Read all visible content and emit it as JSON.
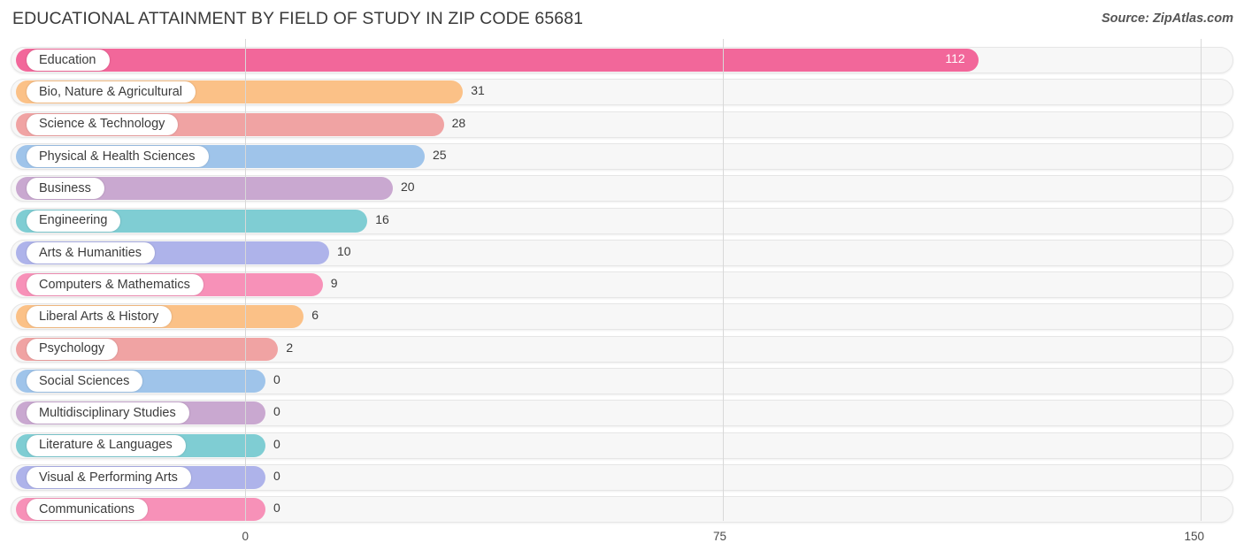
{
  "header": {
    "title": "EDUCATIONAL ATTAINMENT BY FIELD OF STUDY IN ZIP CODE 65681",
    "source": "Source: ZipAtlas.com"
  },
  "chart_data": {
    "type": "bar",
    "orientation": "horizontal",
    "title": "EDUCATIONAL ATTAINMENT BY FIELD OF STUDY IN ZIP CODE 65681",
    "xlabel": "",
    "ylabel": "",
    "xlim": [
      0,
      150
    ],
    "xticks": [
      0,
      75,
      150
    ],
    "xtick_labels": [
      "0",
      "75",
      "150"
    ],
    "grid": true,
    "legend": false,
    "categories": [
      "Education",
      "Bio, Nature & Agricultural",
      "Science & Technology",
      "Physical & Health Sciences",
      "Business",
      "Engineering",
      "Arts & Humanities",
      "Computers & Mathematics",
      "Liberal Arts & History",
      "Psychology",
      "Social Sciences",
      "Multidisciplinary Studies",
      "Literature & Languages",
      "Visual & Performing Arts",
      "Communications"
    ],
    "values": [
      112,
      31,
      28,
      25,
      20,
      16,
      10,
      9,
      6,
      2,
      0,
      0,
      0,
      0,
      0
    ],
    "value_labels": [
      "112",
      "31",
      "28",
      "25",
      "20",
      "16",
      "10",
      "9",
      "6",
      "2",
      "0",
      "0",
      "0",
      "0",
      "0"
    ],
    "colors": [
      "#f2679a",
      "#fbc187",
      "#f0a3a3",
      "#9fc4ea",
      "#c9a8d0",
      "#7fcdd3",
      "#aeb3ea",
      "#f791b8",
      "#fbc187",
      "#f0a3a3",
      "#9fc4ea",
      "#c9a8d0",
      "#7fcdd3",
      "#aeb3ea",
      "#f791b8"
    ]
  },
  "colors": {
    "track_fill": "#f7f7f7",
    "track_border": "#e6e6e6",
    "gridline": "#d8d8d8",
    "text": "#3c3c3c",
    "title": "#3a3a3a"
  }
}
